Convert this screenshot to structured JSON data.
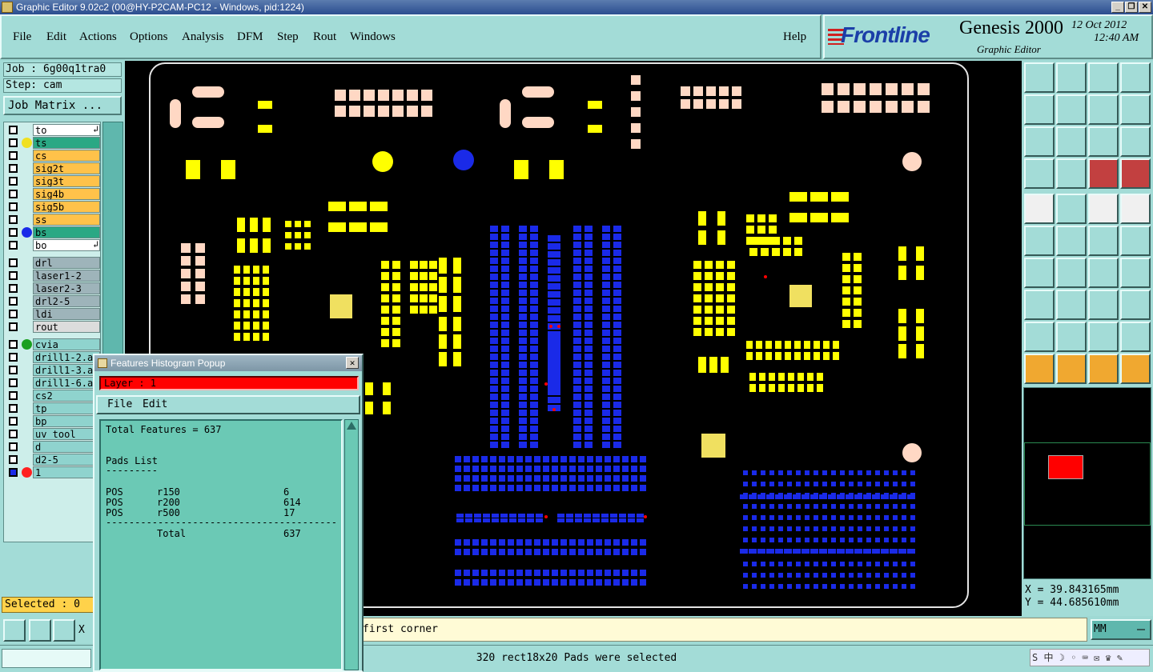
{
  "window": {
    "title": "Graphic Editor 9.02c2 (00@HY-P2CAM-PC12 - Windows, pid:1224)",
    "buttons": [
      "_",
      "❐",
      "✕"
    ]
  },
  "menu": [
    "File",
    "Edit",
    "Actions",
    "Options",
    "Analysis",
    "DFM",
    "Step",
    "Rout",
    "Windows"
  ],
  "help_label": "Help",
  "brand": {
    "logo": "Frontline",
    "product": "Genesis 2000",
    "subtitle": "Graphic Editor",
    "date": "12 Oct 2012",
    "time": "12:40 AM"
  },
  "job": {
    "job_label": "Job : 6g00q1tra0",
    "step_label": "Step: cam",
    "matrix_button": "Job Matrix ..."
  },
  "layers": [
    {
      "name": "to",
      "dot": "",
      "bg": "#ffffff",
      "mark": "↲"
    },
    {
      "name": "ts",
      "dot": "#f0e020",
      "bg": "#2aa884",
      "mark": ""
    },
    {
      "name": "cs",
      "dot": "",
      "bg": "#ffc24a",
      "mark": ""
    },
    {
      "name": "sig2t",
      "dot": "",
      "bg": "#ffc24a",
      "mark": ""
    },
    {
      "name": "sig3t",
      "dot": "",
      "bg": "#ffc24a",
      "mark": ""
    },
    {
      "name": "sig4b",
      "dot": "",
      "bg": "#ffc24a",
      "mark": ""
    },
    {
      "name": "sig5b",
      "dot": "",
      "bg": "#ffc24a",
      "mark": ""
    },
    {
      "name": "ss",
      "dot": "",
      "bg": "#ffc24a",
      "mark": ""
    },
    {
      "name": "bs",
      "dot": "#1a2ae8",
      "bg": "#2aa884",
      "mark": ""
    },
    {
      "name": "bo",
      "dot": "",
      "bg": "#ffffff",
      "mark": "↲"
    },
    {
      "name": "drl",
      "dot": "",
      "bg": "#9eb4ba",
      "mark": ""
    },
    {
      "name": "laser1-2",
      "dot": "",
      "bg": "#9eb4ba",
      "mark": ""
    },
    {
      "name": "laser2-3",
      "dot": "",
      "bg": "#9eb4ba",
      "mark": ""
    },
    {
      "name": "drl2-5",
      "dot": "",
      "bg": "#9eb4ba",
      "mark": ""
    },
    {
      "name": "ldi",
      "dot": "",
      "bg": "#9eb4ba",
      "mark": ""
    },
    {
      "name": "rout",
      "dot": "",
      "bg": "#dcdcdc",
      "mark": ""
    },
    {
      "name": "cvia",
      "dot": "#1aa020",
      "bg": "#8fd3ce",
      "mark": ""
    },
    {
      "name": "drill1-2.a",
      "dot": "",
      "bg": "#8fd3ce",
      "mark": ""
    },
    {
      "name": "drill1-3.a",
      "dot": "",
      "bg": "#8fd3ce",
      "mark": ""
    },
    {
      "name": "drill1-6.a",
      "dot": "",
      "bg": "#8fd3ce",
      "mark": ""
    },
    {
      "name": "cs2",
      "dot": "",
      "bg": "#8fd3ce",
      "mark": ""
    },
    {
      "name": "tp",
      "dot": "",
      "bg": "#8fd3ce",
      "mark": ""
    },
    {
      "name": "bp",
      "dot": "",
      "bg": "#8fd3ce",
      "mark": ""
    },
    {
      "name": "uv_tool",
      "dot": "",
      "bg": "#8fd3ce",
      "mark": ""
    },
    {
      "name": "d",
      "dot": "",
      "bg": "#8fd3ce",
      "mark": ""
    },
    {
      "name": "d2-5",
      "dot": "",
      "bg": "#8fd3ce",
      "mark": ""
    },
    {
      "name": "1",
      "dot": "#ff2020",
      "bg": "#8fd3ce",
      "mark": ""
    }
  ],
  "selected_label": "Selected : 0",
  "popup": {
    "title": "Features Histogram Popup",
    "layer_label": "Layer :  1",
    "menu": [
      "File",
      "Edit"
    ],
    "total": "Total Features = 637",
    "pads_title": "Pads List",
    "underline": "---------",
    "rows": [
      {
        "pol": "POS",
        "sym": "r150",
        "count": "6"
      },
      {
        "pol": "POS",
        "sym": "r200",
        "count": "614"
      },
      {
        "pol": "POS",
        "sym": "r500",
        "count": "17"
      }
    ],
    "separator": "----------------------------------------",
    "total_row": {
      "label": "Total",
      "count": "637"
    }
  },
  "coords": {
    "x": "X = 39.843165mm",
    "y": "Y = 44.685610mm"
  },
  "prompt": {
    "left": "X",
    "text": "first corner"
  },
  "units": "MM",
  "status": "320 rect18x20 Pads were selected",
  "tray": "S 中 ☽ ◦ ⌨ ✉ ♛ ✎",
  "tools": [
    "up-arrow-box-icon",
    "down-arrow-box-icon",
    "home-icon",
    "window-icon",
    "left-arrow-box-icon",
    "right-arrow-box-icon",
    "swap-left-icon",
    "s-route-icon",
    "fit-arrows-icon",
    "zoom-arrows-icon",
    "one-to-two-icon",
    "help-question-icon",
    "measure-tools-icon",
    "grid-icon",
    "snap-red-icon",
    "snap-red-alt-icon",
    "camera-icon",
    "polygon-edit-icon",
    "ruler-icon",
    "dashed-circle-icon",
    "pad-move-icon",
    "pad-center-icon",
    "pad-diagonal-icon",
    "pad-diag-alt-icon",
    "angle-line-icon",
    "line-draw-icon",
    "arc-icon",
    "split-icon",
    "pad-add-icon",
    "line-cut-icon",
    "fit-horizontal-icon",
    "cluster-icon",
    "triangle-red-icon",
    "triangle-blue-icon",
    "triangle-line-icon",
    "triangle-cross-icon",
    "pointer-icon",
    "select-box-icon",
    "select-arrow-icon",
    "route-node-icon"
  ],
  "colors": {
    "yellow_pad": "#ffff00",
    "blue_pad": "#1a2ae8",
    "salmon_pad": "#ffd8c4",
    "accent_red": "#ff0000"
  }
}
